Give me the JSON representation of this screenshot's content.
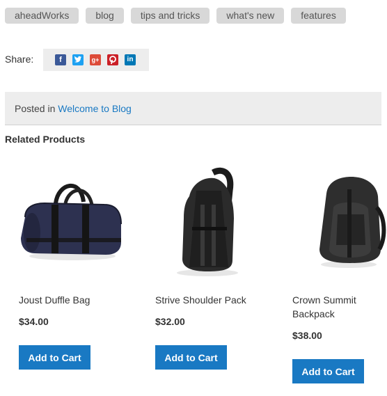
{
  "tags": [
    "aheadWorks",
    "blog",
    "tips and tricks",
    "what's new",
    "features"
  ],
  "share": {
    "label": "Share:",
    "icons": [
      {
        "name": "facebook-icon",
        "glyph": "f",
        "color": "#3b5998"
      },
      {
        "name": "twitter-icon",
        "glyph": "t",
        "color": "#1da1f2"
      },
      {
        "name": "google-plus-icon",
        "glyph": "g+",
        "color": "#dd4b39"
      },
      {
        "name": "pinterest-icon",
        "glyph": "p",
        "color": "#cb2027"
      },
      {
        "name": "linkedin-icon",
        "glyph": "in",
        "color": "#0077b5"
      }
    ]
  },
  "posted": {
    "prefix": "Posted in",
    "category": "Welcome to Blog"
  },
  "related": {
    "title": "Related Products",
    "products": [
      {
        "name": "Joust Duffle Bag",
        "price": "$34.00",
        "button": "Add to Cart"
      },
      {
        "name": "Strive Shoulder Pack",
        "price": "$32.00",
        "button": "Add to Cart"
      },
      {
        "name": "Crown Summit Backpack",
        "price": "$38.00",
        "button": "Add to Cart"
      }
    ]
  },
  "colors": {
    "accent": "#1979c3",
    "tag_bg": "#d8d8d8",
    "panel_bg": "#ededed"
  }
}
